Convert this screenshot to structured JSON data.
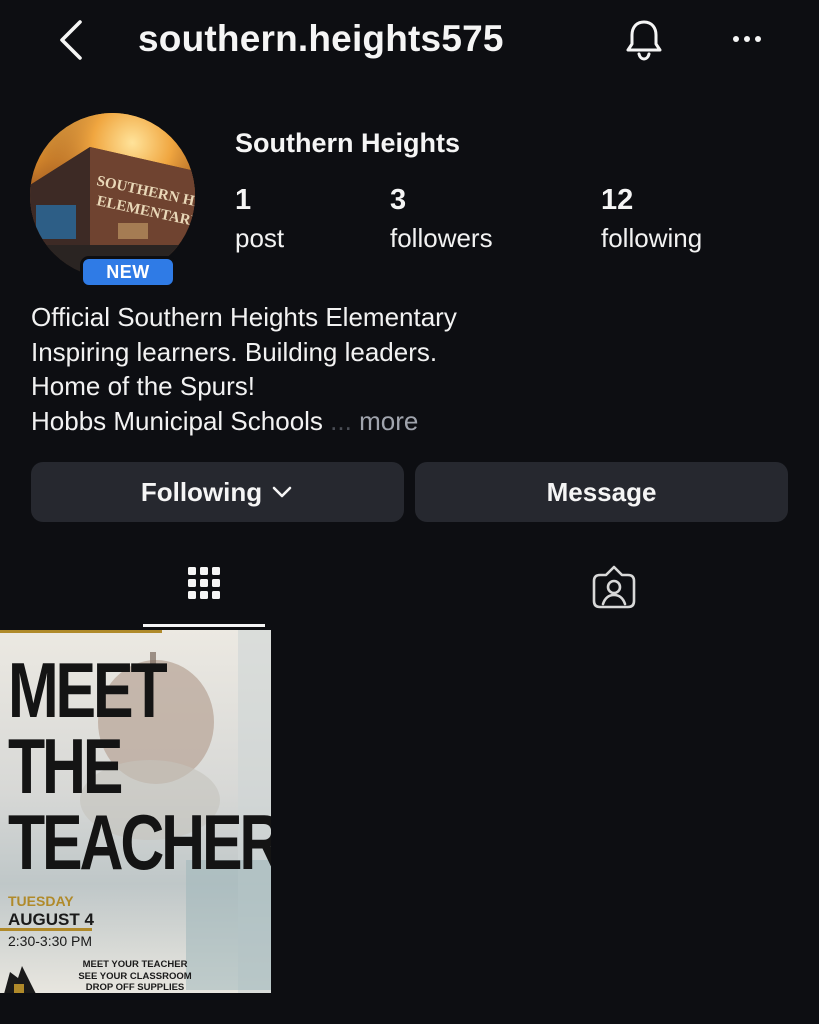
{
  "header": {
    "username": "southern.heights575",
    "back_icon": "chevron-left-icon",
    "bell_icon": "bell-icon",
    "more_icon": "more-horizontal-icon"
  },
  "profile": {
    "display_name": "Southern Heights",
    "avatar_sign": [
      "SOUTHERN HEIGHTS",
      "ELEMENTARY"
    ],
    "badge": "NEW",
    "stats": [
      {
        "count": "1",
        "label": "post"
      },
      {
        "count": "3",
        "label": "followers"
      },
      {
        "count": "12",
        "label": "following"
      }
    ],
    "bio": [
      "Official Southern Heights Elementary",
      "Inspiring learners. Building leaders.",
      "Home of the Spurs!",
      "Hobbs Municipal Schools"
    ],
    "bio_ellipsis": "...",
    "bio_more": "more"
  },
  "actions": {
    "following_label": "Following",
    "message_label": "Message"
  },
  "tabs": [
    {
      "name": "grid",
      "icon": "grid-icon",
      "active": true
    },
    {
      "name": "tagged",
      "icon": "tagged-person-icon",
      "active": false
    }
  ],
  "posts": [
    {
      "title_lines": [
        "MEET",
        "THE",
        "TEACHER"
      ],
      "day": "TUESDAY",
      "date": "AUGUST 4",
      "time": "2:30-3:30 PM",
      "tagline": [
        "MEET YOUR TEACHER",
        "SEE YOUR CLASSROOM",
        "DROP OFF SUPPLIES"
      ]
    }
  ],
  "colors": {
    "background": "#0d0e12",
    "button": "#26282f",
    "badge": "#2f7be6",
    "accent_gold": "#b08a2a"
  }
}
